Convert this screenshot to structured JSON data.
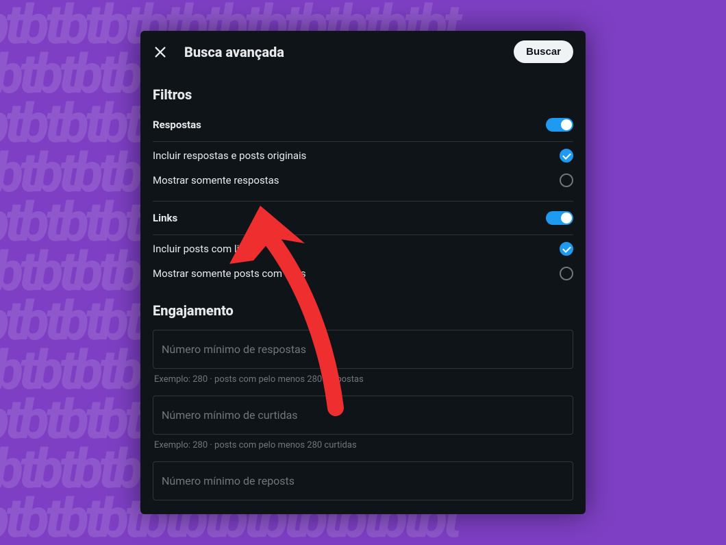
{
  "header": {
    "title": "Busca avançada",
    "search_button": "Buscar"
  },
  "filters": {
    "section_title": "Filtros",
    "respostas": {
      "label": "Respostas",
      "opt_include": "Incluir respostas e posts originais",
      "opt_only": "Mostrar somente respostas"
    },
    "links": {
      "label": "Links",
      "opt_include": "Incluir posts com links",
      "opt_only": "Mostrar somente posts com links"
    }
  },
  "engajamento": {
    "section_title": "Engajamento",
    "min_respostas": {
      "placeholder": "Número mínimo de respostas",
      "hint": "Exemplo: 280 · posts com pelo menos 280 respostas"
    },
    "min_curtidas": {
      "placeholder": "Número mínimo de curtidas",
      "hint": "Exemplo: 280 · posts com pelo menos 280 curtidas"
    },
    "min_reposts": {
      "placeholder": "Número mínimo de reposts"
    }
  },
  "colors": {
    "accent": "#1d9bf0",
    "surface": "#0f1419",
    "text": "#e7e9ea",
    "muted": "#71767b",
    "annotation": "#ef2f2f"
  }
}
